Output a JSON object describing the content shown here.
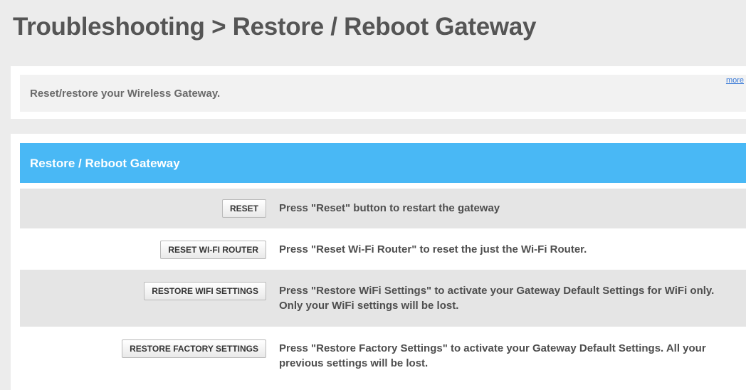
{
  "page": {
    "title": "Troubleshooting > Restore / Reboot Gateway"
  },
  "info": {
    "text": "Reset/restore your Wireless Gateway.",
    "more_label": "more"
  },
  "section": {
    "title": "Restore / Reboot Gateway"
  },
  "actions": [
    {
      "button_label": "RESET",
      "description": "Press \"Reset\" button to restart the gateway"
    },
    {
      "button_label": "RESET WI-FI ROUTER",
      "description": "Press \"Reset Wi-Fi Router\" to reset the just the Wi-Fi Router."
    },
    {
      "button_label": "RESTORE WIFI SETTINGS",
      "description": "Press \"Restore WiFi Settings\" to activate your Gateway Default Settings for WiFi only. Only your WiFi settings will be lost."
    },
    {
      "button_label": "RESTORE FACTORY SETTINGS",
      "description": "Press \"Restore Factory Settings\" to activate your Gateway Default Settings. All your previous settings will be lost."
    }
  ],
  "colors": {
    "accent": "#49b8f5",
    "title_text": "#555555",
    "link": "#3a7ad8",
    "row_shade": "#e5e5e5"
  }
}
